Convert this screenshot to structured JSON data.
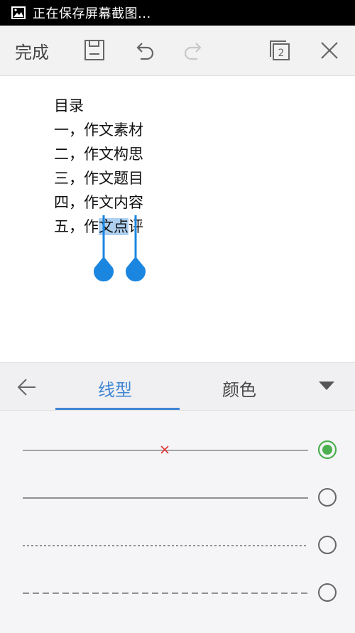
{
  "status_bar": {
    "text": "正在保存屏幕截图...",
    "icon": "image-icon"
  },
  "toolbar": {
    "done_label": "完成",
    "icons": [
      "save-icon",
      "undo-icon",
      "redo-icon",
      "pages-icon",
      "close-icon"
    ],
    "page_count": "2"
  },
  "document": {
    "lines": [
      "目录",
      "一，作文素材",
      "二，作文构思",
      "三，作文题目",
      "四，作文内容"
    ],
    "last_line": {
      "before": "五，作",
      "selected": "文点",
      "after": "评"
    },
    "selection_color": "#aed0f0",
    "handle_color": "#1a86e0"
  },
  "panel": {
    "back_icon": "arrow-left-icon",
    "tabs": [
      {
        "label": "线型",
        "active": true
      },
      {
        "label": "颜色",
        "active": false
      }
    ],
    "dropdown_icon": "triangle-down-icon",
    "line_styles": [
      {
        "style": "none",
        "selected": true
      },
      {
        "style": "solid",
        "selected": false
      },
      {
        "style": "dotted",
        "selected": false
      },
      {
        "style": "dashed",
        "selected": false
      }
    ],
    "accent_color": "#4caf50",
    "tab_active_color": "#3f86d4"
  }
}
